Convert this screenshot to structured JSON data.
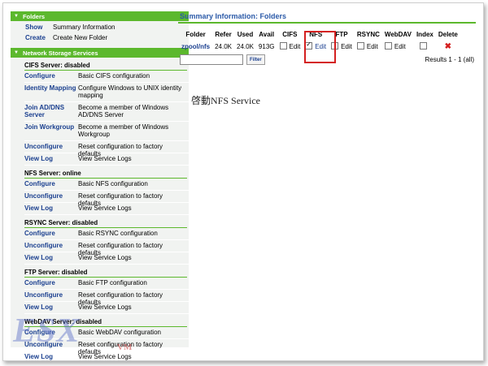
{
  "sidebar": {
    "folders_header": "Folders",
    "folders_items": [
      {
        "link": "Show",
        "desc": "Summary Information"
      },
      {
        "link": "Create",
        "desc": "Create New Folder"
      }
    ],
    "nss_header": "Network Storage Services",
    "services": [
      {
        "title": "CIFS Server: disabled",
        "items": [
          {
            "link": "Configure",
            "desc": "Basic CIFS configuration"
          },
          {
            "link": "Identity Mapping",
            "desc": "Configure Windows to UNIX identity mapping"
          },
          {
            "link": "Join AD/DNS Server",
            "desc": "Become a member of Windows AD/DNS Server"
          },
          {
            "link": "Join Workgroup",
            "desc": "Become a member of Windows Workgroup"
          },
          {
            "link": "Unconfigure",
            "desc": "Reset configuration to factory defaults"
          },
          {
            "link": "View Log",
            "desc": "View Service Logs"
          }
        ]
      },
      {
        "title": "NFS Server: online",
        "items": [
          {
            "link": "Configure",
            "desc": "Basic NFS configuration"
          },
          {
            "link": "Unconfigure",
            "desc": "Reset configuration to factory defaults"
          },
          {
            "link": "View Log",
            "desc": "View Service Logs"
          }
        ]
      },
      {
        "title": "RSYNC Server: disabled",
        "items": [
          {
            "link": "Configure",
            "desc": "Basic RSYNC configuration"
          },
          {
            "link": "Unconfigure",
            "desc": "Reset configuration to factory defaults"
          },
          {
            "link": "View Log",
            "desc": "View Service Logs"
          }
        ]
      },
      {
        "title": "FTP Server: disabled",
        "items": [
          {
            "link": "Configure",
            "desc": "Basic FTP configuration"
          },
          {
            "link": "Unconfigure",
            "desc": "Reset configuration to factory defaults"
          },
          {
            "link": "View Log",
            "desc": "View Service Logs"
          }
        ]
      },
      {
        "title": "WebDAV Server: disabled",
        "items": [
          {
            "link": "Configure",
            "desc": "Basic WebDAV configuration"
          },
          {
            "link": "Unconfigure",
            "desc": "Reset configuration to factory defaults"
          },
          {
            "link": "View Log",
            "desc": "View Service Logs"
          }
        ]
      }
    ]
  },
  "main": {
    "title": "Summary Information: Folders",
    "columns": [
      "Folder",
      "Refer",
      "Used",
      "Avail",
      "CIFS",
      "NFS",
      "FTP",
      "RSYNC",
      "WebDAV",
      "Index",
      "Delete"
    ],
    "row": {
      "folder": "zpool/nfs",
      "refer": "24.0K",
      "used": "24.0K",
      "avail": "913G",
      "edit_label": "Edit",
      "nfs_checked": true
    },
    "filter_button": "Filter",
    "filter_value": "",
    "results": "Results 1 - 1 (all)",
    "note": "啓動NFS Service"
  },
  "watermark": {
    "main": "ESX",
    "sub": "VM"
  },
  "colors": {
    "accent_green": "#5cb82d",
    "link_blue": "#1a3f8f",
    "highlight_red": "#d42020"
  }
}
